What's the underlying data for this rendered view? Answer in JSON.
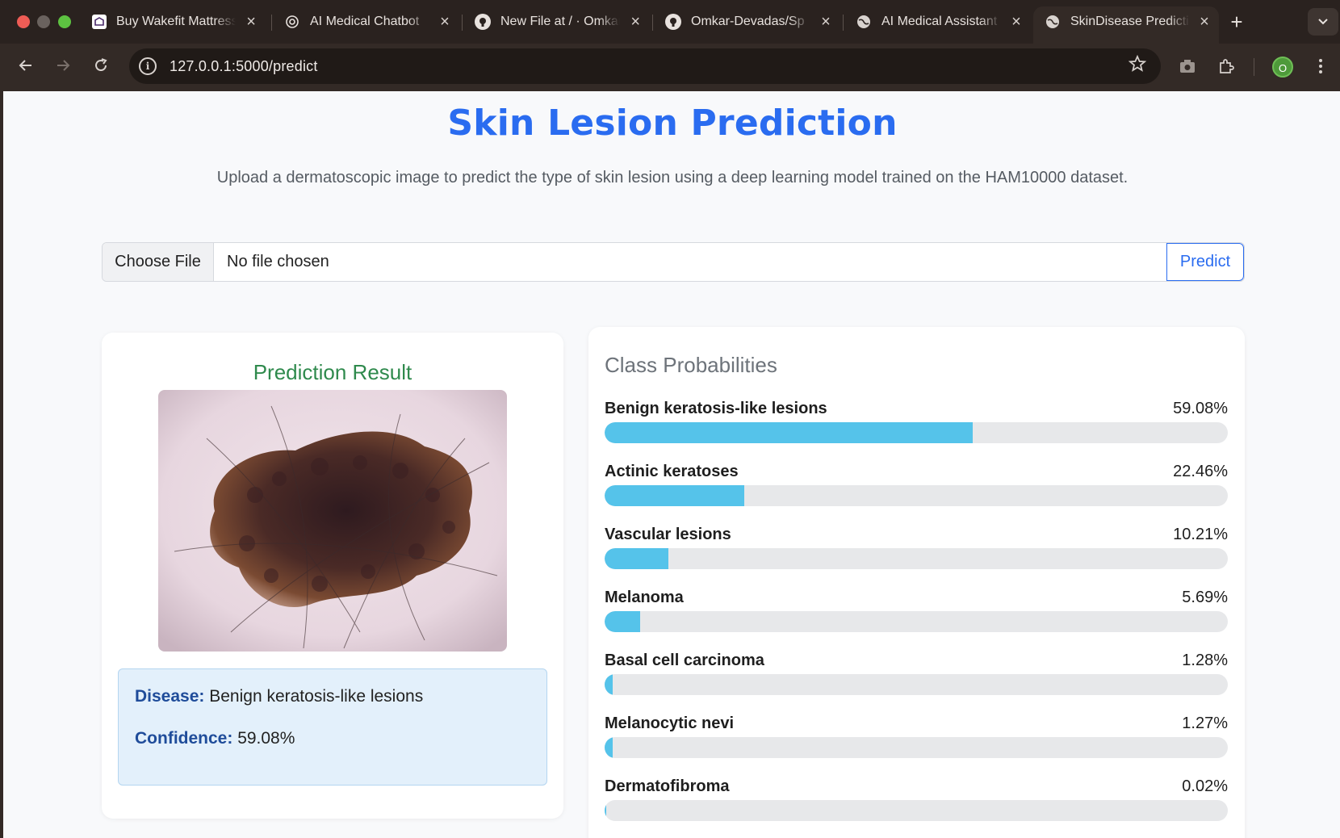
{
  "browser": {
    "tabs": [
      {
        "title": "Buy Wakefit Mattress",
        "favicon": "wakefit-icon"
      },
      {
        "title": "AI Medical Chatbot",
        "favicon": "openai-icon"
      },
      {
        "title": "New File at / · Omkar",
        "favicon": "github-icon"
      },
      {
        "title": "Omkar-Devadas/Sp",
        "favicon": "github-icon"
      },
      {
        "title": "AI Medical Assistant",
        "favicon": "globe-icon"
      },
      {
        "title": "SkinDisease Prediction",
        "favicon": "globe-icon",
        "active": true
      }
    ],
    "url": "127.0.0.1:5000/predict",
    "profile_initial": "O"
  },
  "page": {
    "title": "Skin Lesion Prediction",
    "subtitle": "Upload a dermatoscopic image to predict the type of skin lesion using a deep learning model trained on the HAM10000 dataset.",
    "file_input": {
      "choose_label": "Choose File",
      "status": "No file chosen"
    },
    "predict_label": "Predict",
    "result": {
      "heading": "Prediction Result",
      "disease_label": "Disease:",
      "disease_value": "Benign keratosis-like lesions",
      "confidence_label": "Confidence:",
      "confidence_value": "59.08%"
    },
    "probabilities": {
      "heading": "Class Probabilities",
      "items": [
        {
          "label": "Benign keratosis-like lesions",
          "value_text": "59.08%",
          "value": 59.08
        },
        {
          "label": "Actinic keratoses",
          "value_text": "22.46%",
          "value": 22.46
        },
        {
          "label": "Vascular lesions",
          "value_text": "10.21%",
          "value": 10.21
        },
        {
          "label": "Melanoma",
          "value_text": "5.69%",
          "value": 5.69
        },
        {
          "label": "Basal cell carcinoma",
          "value_text": "1.28%",
          "value": 1.28
        },
        {
          "label": "Melanocytic nevi",
          "value_text": "1.27%",
          "value": 1.27
        },
        {
          "label": "Dermatofibroma",
          "value_text": "0.02%",
          "value": 0.02
        }
      ]
    }
  },
  "colors": {
    "title": "#2a6cf0",
    "result_heading": "#2f8a4d",
    "bar_fill": "#55c3ea",
    "bar_track": "#e7e8ea",
    "info_bg": "#e3f0fb"
  }
}
